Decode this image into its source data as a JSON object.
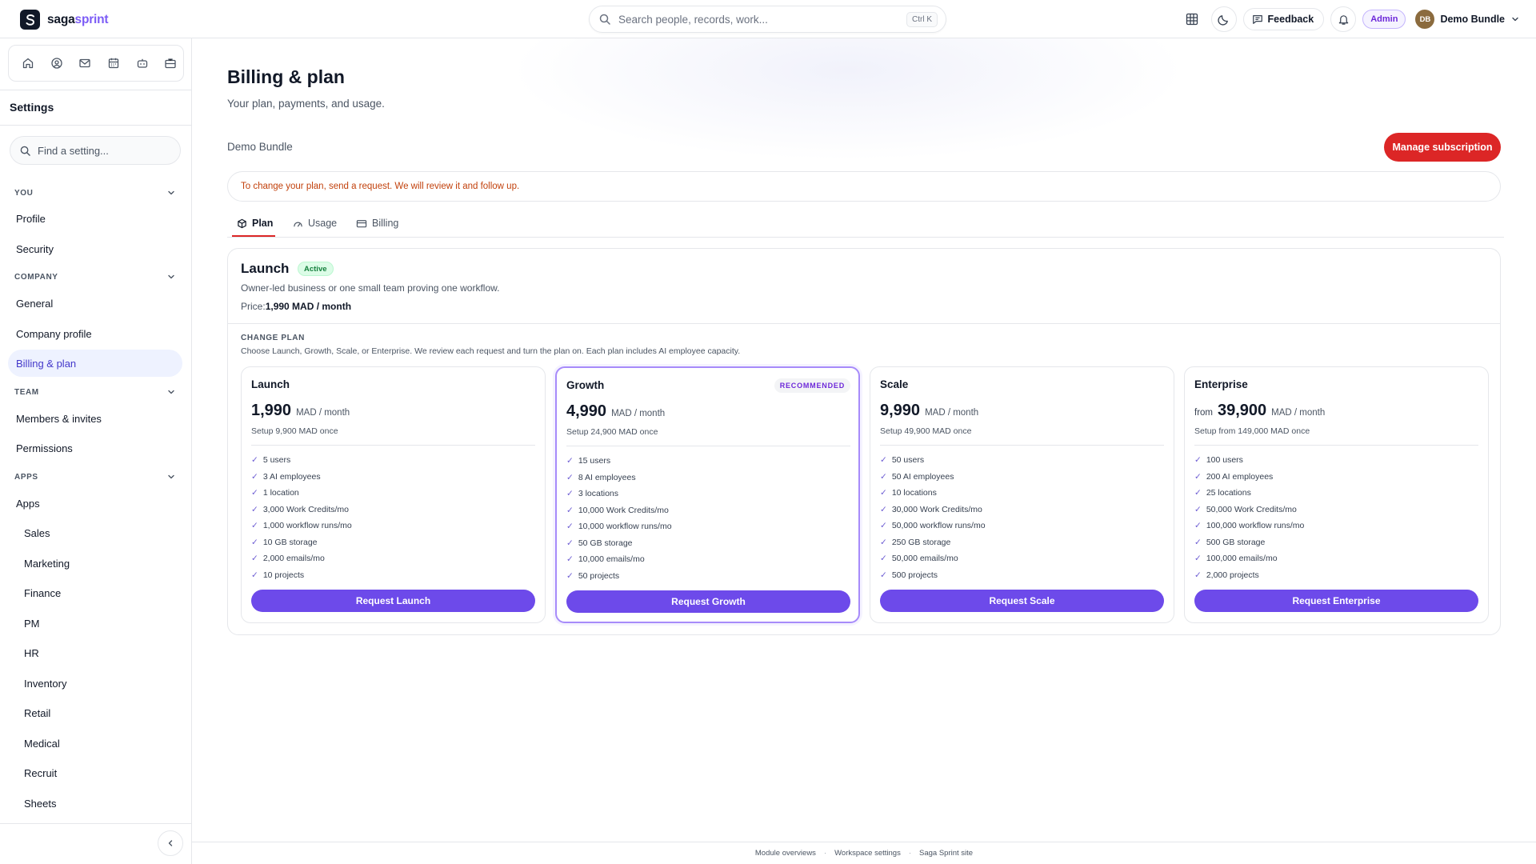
{
  "brand": {
    "name_black": "saga",
    "name_accent": "sprint",
    "accent_color": "#7c5cf6"
  },
  "search": {
    "placeholder": "Search people, records, work...",
    "shortcut": "Ctrl K"
  },
  "topbar": {
    "feedback_label": "Feedback",
    "role_badge": "Admin",
    "user_initials": "DB",
    "user_name": "Demo Bundle",
    "icons": [
      "grid-icon",
      "moon-icon",
      "feedback-icon",
      "bell-icon",
      "chevron-down-icon"
    ]
  },
  "sidebar": {
    "app_icons": [
      "home-icon",
      "user-circle-icon",
      "mail-icon",
      "calendar-icon",
      "bot-icon",
      "briefcase-icon"
    ],
    "title": "Settings",
    "search_placeholder": "Find a setting...",
    "sections": {
      "you": "YOU",
      "company": "COMPANY",
      "team": "TEAM",
      "apps": "APPS"
    },
    "items": {
      "profile": "Profile",
      "security": "Security",
      "general": "General",
      "company_profile": "Company profile",
      "billing": "Billing & plan",
      "members": "Members & invites",
      "permissions": "Permissions",
      "apps": "Apps",
      "sales": "Sales",
      "marketing": "Marketing",
      "finance": "Finance",
      "pm": "PM",
      "hr": "HR",
      "inventory": "Inventory",
      "retail": "Retail",
      "medical": "Medical",
      "recruit": "Recruit",
      "sheets": "Sheets"
    },
    "active_item": "billing"
  },
  "page": {
    "title": "Billing & plan",
    "subtitle": "Your plan, payments, and usage.",
    "org_name": "Demo Bundle",
    "manage_button": "Manage subscription",
    "notice": "To change your plan, send a request. We will review it and follow up.",
    "tabs": {
      "plan": "Plan",
      "usage": "Usage",
      "billing": "Billing"
    },
    "active_tab": "plan"
  },
  "current_plan": {
    "name": "Launch",
    "status": "Active",
    "description": "Owner-led business or one small team proving one workflow.",
    "price_label": "Price:",
    "price_value": "1,990 MAD / month"
  },
  "change_plan": {
    "label": "CHANGE PLAN",
    "description": "Choose Launch, Growth, Scale, or Enterprise. We review each request and turn the plan on. Each plan includes AI employee capacity."
  },
  "plans": [
    {
      "name": "Launch",
      "badge": "",
      "from": "",
      "amount": "1,990",
      "unit": "MAD / month",
      "setup": "Setup 9,900 MAD once",
      "features": [
        "5 users",
        "3 AI employees",
        "1 location",
        "3,000 Work Credits/mo",
        "1,000 workflow runs/mo",
        "10 GB storage",
        "2,000 emails/mo",
        "10 projects"
      ],
      "button": "Request Launch"
    },
    {
      "name": "Growth",
      "badge": "RECOMMENDED",
      "from": "",
      "amount": "4,990",
      "unit": "MAD / month",
      "setup": "Setup 24,900 MAD once",
      "features": [
        "15 users",
        "8 AI employees",
        "3 locations",
        "10,000 Work Credits/mo",
        "10,000 workflow runs/mo",
        "50 GB storage",
        "10,000 emails/mo",
        "50 projects"
      ],
      "button": "Request Growth"
    },
    {
      "name": "Scale",
      "badge": "",
      "from": "",
      "amount": "9,990",
      "unit": "MAD / month",
      "setup": "Setup 49,900 MAD once",
      "features": [
        "50 users",
        "50 AI employees",
        "10 locations",
        "30,000 Work Credits/mo",
        "50,000 workflow runs/mo",
        "250 GB storage",
        "50,000 emails/mo",
        "500 projects"
      ],
      "button": "Request Scale"
    },
    {
      "name": "Enterprise",
      "badge": "",
      "from": "from",
      "amount": "39,900",
      "unit": "MAD / month",
      "setup": "Setup from 149,000 MAD once",
      "features": [
        "100 users",
        "200 AI employees",
        "25 locations",
        "50,000 Work Credits/mo",
        "100,000 workflow runs/mo",
        "500 GB storage",
        "100,000 emails/mo",
        "2,000 projects"
      ],
      "button": "Request Enterprise"
    }
  ],
  "footer": {
    "links": [
      "Module overviews",
      "Workspace settings",
      "Saga Sprint site"
    ]
  },
  "colors": {
    "danger": "#dc2626",
    "primary": "#6d4aea",
    "active_nav_bg": "#eef2ff",
    "active_nav_text": "#4338ca",
    "notice_text": "#c2410c"
  }
}
